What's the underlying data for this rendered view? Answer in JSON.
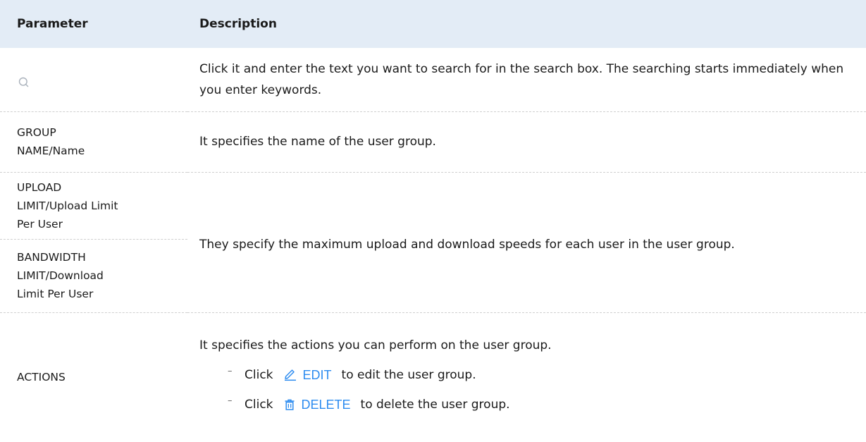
{
  "table": {
    "header": {
      "parameter": "Parameter",
      "description": "Description"
    },
    "rows": {
      "search": {
        "icon": "search-icon",
        "description": "Click it and enter the text you want to search for in the search box. The searching starts immediately when you enter keywords."
      },
      "group_name": {
        "parameter_line1": "GROUP",
        "parameter_line2": "NAME/Name",
        "description": "It specifies the name of the user group."
      },
      "upload_limit": {
        "parameter_line1": "UPLOAD",
        "parameter_line2": "LIMIT/Upload Limit",
        "parameter_line3": "Per User"
      },
      "bandwidth_limit": {
        "parameter_line1": "BANDWIDTH",
        "parameter_line2": "LIMIT/Download",
        "parameter_line3": "Limit Per User"
      },
      "limits_description": "They specify the maximum upload and download speeds for each user in the user group.",
      "actions": {
        "parameter": "ACTIONS",
        "intro": "It specifies the actions you can perform on the user group.",
        "items": [
          {
            "bullet": "–",
            "click": "Click",
            "button_label": "EDIT",
            "icon": "pencil-icon",
            "suffix": "to edit the user group."
          },
          {
            "bullet": "–",
            "click": "Click",
            "button_label": "DELETE",
            "icon": "trash-icon",
            "suffix": "to delete the user group."
          }
        ]
      }
    }
  },
  "colors": {
    "header_bg": "#e3ecf6",
    "accent": "#2d8cf0",
    "divider": "#cfcfcf"
  }
}
